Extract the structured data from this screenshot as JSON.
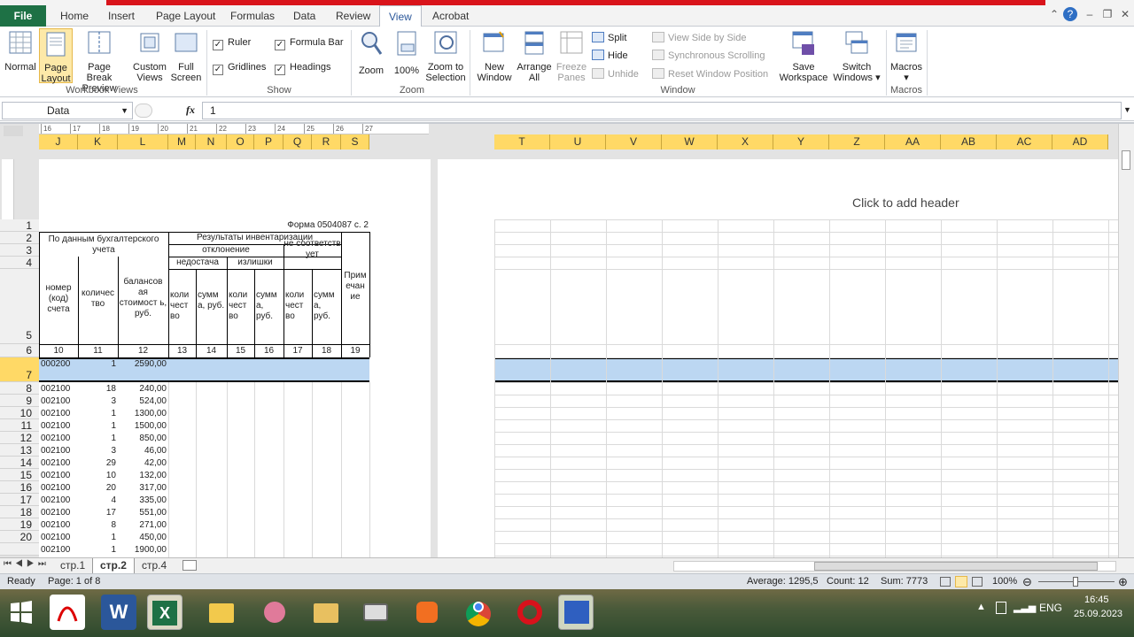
{
  "ribbon_tabs": [
    {
      "label": "Home"
    },
    {
      "label": "Insert"
    },
    {
      "label": "Page Layout"
    },
    {
      "label": "Formulas"
    },
    {
      "label": "Data"
    },
    {
      "label": "Review"
    },
    {
      "label": "View",
      "active": true
    },
    {
      "label": "Acrobat"
    }
  ],
  "file_tab": "File",
  "workbook_views": {
    "normal": "Normal",
    "page_layout_1": "Page",
    "page_layout_2": "Layout",
    "page_break_1": "Page Break",
    "page_break_2": "Preview",
    "custom_1": "Custom",
    "custom_2": "Views",
    "full_1": "Full",
    "full_2": "Screen",
    "group": "Workbook Views"
  },
  "show": {
    "ruler": "Ruler",
    "gridlines": "Gridlines",
    "formula_bar": "Formula Bar",
    "headings": "Headings",
    "group": "Show"
  },
  "zoom": {
    "zoom": "Zoom",
    "hundred": "100%",
    "sel_1": "Zoom to",
    "sel_2": "Selection",
    "group": "Zoom"
  },
  "window": {
    "new_1": "New",
    "new_2": "Window",
    "arrange_1": "Arrange",
    "arrange_2": "All",
    "freeze_1": "Freeze",
    "freeze_2": "Panes",
    "split": "Split",
    "hide": "Hide",
    "unhide": "Unhide",
    "side": "View Side by Side",
    "sync": "Synchronous Scrolling",
    "reset": "Reset Window Position",
    "save_1": "Save",
    "save_2": "Workspace",
    "switch_1": "Switch",
    "switch_2": "Windows",
    "group": "Window"
  },
  "macros": {
    "label": "Macros",
    "group": "Macros"
  },
  "formula": {
    "name_box": "Data",
    "fx": "fx",
    "value": "1"
  },
  "columns_left": [
    "J",
    "K",
    "L",
    "M",
    "N",
    "O",
    "P",
    "Q",
    "R",
    "S"
  ],
  "columns_right": [
    "T",
    "U",
    "V",
    "W",
    "X",
    "Y",
    "Z",
    "AA",
    "AB",
    "AC",
    "AD"
  ],
  "ruler_ticks": [
    "16",
    "17",
    "18",
    "19",
    "20",
    "21",
    "22",
    "23",
    "24",
    "25",
    "26",
    "27"
  ],
  "header_placeholder": "Click to add header",
  "form_title": "Форма 0504087 с. 2",
  "hdr": {
    "accounting": "По данным бухгалтерского учета",
    "results": "Результаты инвентаризации",
    "deviation": "отклонение",
    "shortage": "недостача",
    "surplus": "излишки",
    "mismatch": "не соответств ует",
    "code": "номер (код) счета",
    "qty": "количес тво",
    "balance": "балансов ая стоимост ь, руб.",
    "q13": "коли чест во",
    "s14": "сумм а, руб.",
    "q15": "коли чест во",
    "s16": "сумм а, руб.",
    "q17": "коли чест во",
    "s18": "сумм а, руб.",
    "note": "Прим ечан ие"
  },
  "col_numbers": [
    "10",
    "11",
    "12",
    "13",
    "14",
    "15",
    "16",
    "17",
    "18",
    "19"
  ],
  "rows": [
    {
      "row": "7",
      "code": "000200",
      "qty": "1",
      "sum": "2590,00"
    },
    {
      "row": "8",
      "code": "002100",
      "qty": "18",
      "sum": "240,00"
    },
    {
      "row": "9",
      "code": "002100",
      "qty": "3",
      "sum": "524,00"
    },
    {
      "row": "10",
      "code": "002100",
      "qty": "1",
      "sum": "1300,00"
    },
    {
      "row": "11",
      "code": "002100",
      "qty": "1",
      "sum": "1500,00"
    },
    {
      "row": "12",
      "code": "002100",
      "qty": "1",
      "sum": "850,00"
    },
    {
      "row": "13",
      "code": "002100",
      "qty": "3",
      "sum": "46,00"
    },
    {
      "row": "14",
      "code": "002100",
      "qty": "29",
      "sum": "42,00"
    },
    {
      "row": "15",
      "code": "002100",
      "qty": "10",
      "sum": "132,00"
    },
    {
      "row": "16",
      "code": "002100",
      "qty": "20",
      "sum": "317,00"
    },
    {
      "row": "17",
      "code": "002100",
      "qty": "4",
      "sum": "335,00"
    },
    {
      "row": "18",
      "code": "002100",
      "qty": "17",
      "sum": "551,00"
    },
    {
      "row": "19",
      "code": "002100",
      "qty": "8",
      "sum": "271,00"
    },
    {
      "row": "20",
      "code": "002100",
      "qty": "1",
      "sum": "450,00"
    },
    {
      "row": "",
      "code": "002100",
      "qty": "1",
      "sum": "1900,00"
    }
  ],
  "header_rows": [
    "1",
    "2",
    "3",
    "4",
    "5",
    "6"
  ],
  "sheet_tabs": [
    {
      "label": "стр.1"
    },
    {
      "label": "стр.2",
      "active": true
    },
    {
      "label": "стр.4"
    }
  ],
  "status": {
    "ready": "Ready",
    "page": "Page: 1 of 8",
    "average": "Average: 1295,5",
    "count": "Count: 12",
    "sum": "Sum: 7773",
    "zoom": "100%"
  },
  "taskbar": {
    "lang": "ENG",
    "time": "16:45",
    "date": "25.09.2023"
  }
}
